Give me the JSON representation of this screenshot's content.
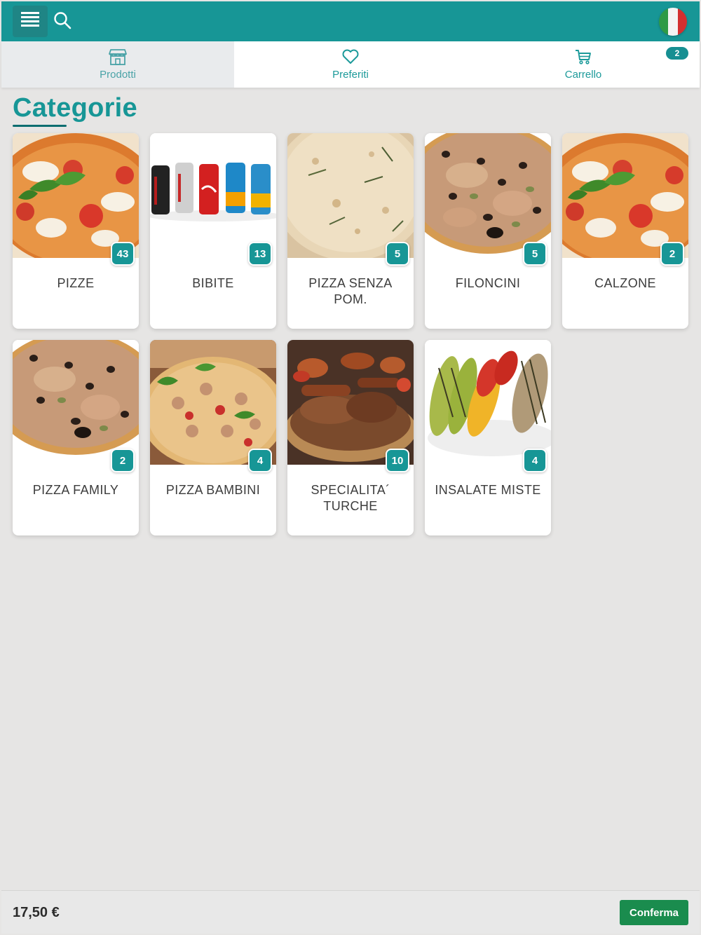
{
  "header": {
    "menu_icon": "menu-icon",
    "search_icon": "search-icon",
    "language_flag": "italy-flag-icon",
    "accent_color": "#179696"
  },
  "tabs": [
    {
      "label": "Prodotti",
      "icon": "store-icon",
      "active": true
    },
    {
      "label": "Preferiti",
      "icon": "heart-icon",
      "active": false
    },
    {
      "label": "Carrello",
      "icon": "cart-icon",
      "active": false,
      "badge": "2"
    }
  ],
  "page": {
    "title": "Categorie"
  },
  "categories": [
    {
      "label": "PIZZE",
      "count": "43",
      "image": "pizza-margherita-photo"
    },
    {
      "label": "BIBITE",
      "count": "13",
      "image": "soft-drink-cans-photo"
    },
    {
      "label": "PIZZA SENZA POM.",
      "count": "5",
      "image": "focaccia-photo"
    },
    {
      "label": "FILONCINI",
      "count": "5",
      "image": "pizza-olives-photo"
    },
    {
      "label": "CALZONE",
      "count": "2",
      "image": "pizza-margherita-photo"
    },
    {
      "label": "PIZZA FAMILY",
      "count": "2",
      "image": "pizza-olives-photo"
    },
    {
      "label": "PIZZA BAMBINI",
      "count": "4",
      "image": "pizza-mushroom-photo"
    },
    {
      "label": "SPECIALITA´ TURCHE",
      "count": "10",
      "image": "grilled-meat-photo"
    },
    {
      "label": "INSALATE MISTE",
      "count": "4",
      "image": "grilled-vegetables-photo"
    }
  ],
  "footer": {
    "total": "17,50 €",
    "confirm_label": "Conferma",
    "confirm_color": "#1a8c4e"
  }
}
